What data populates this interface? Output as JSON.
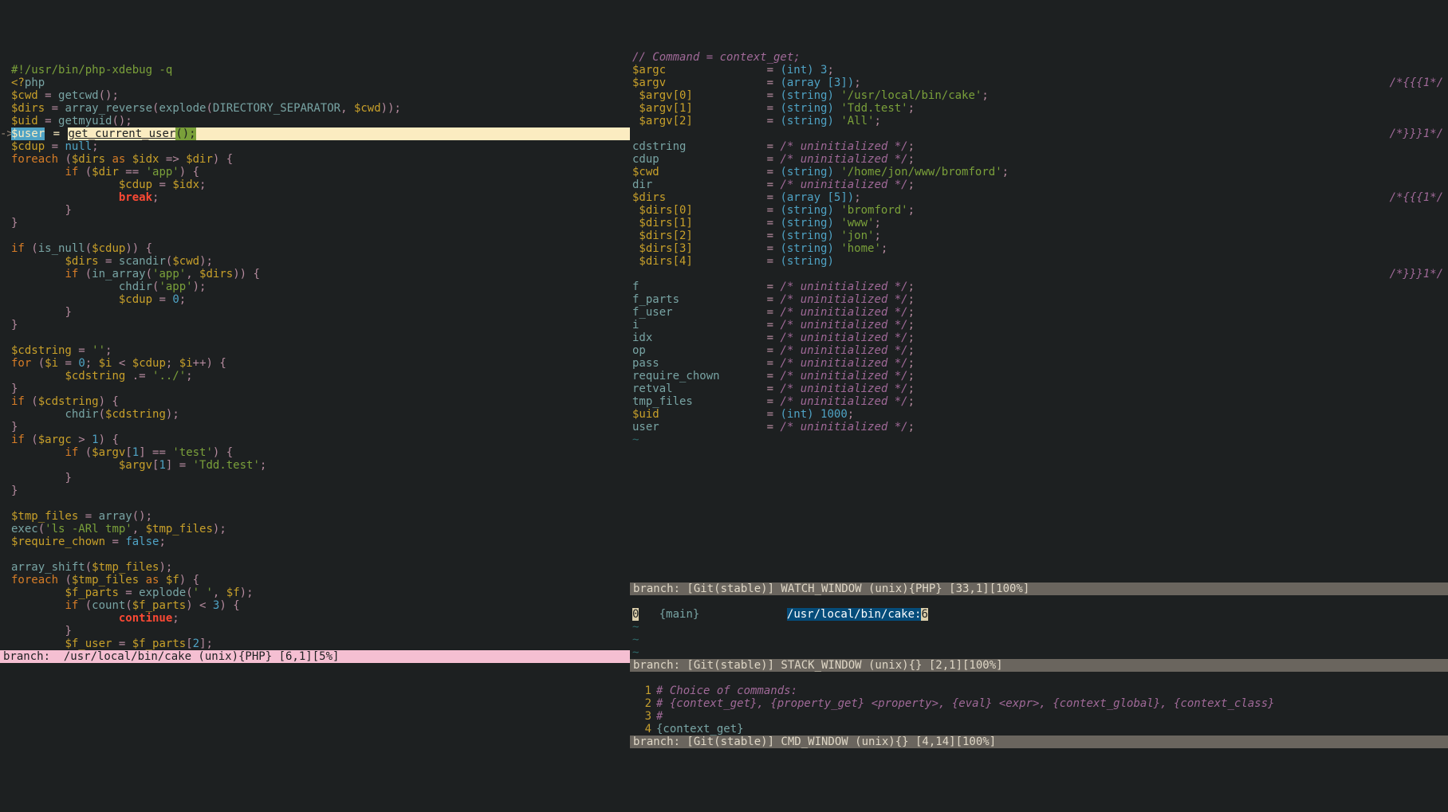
{
  "left": {
    "code": {
      "l1": "#!/usr/bin/php-xdebug -q",
      "l2": "<?php",
      "l3_pre": "$cwd",
      "l3_mid": " = ",
      "l3_fn": "getcwd",
      "l3_post": "();",
      "l4_pre": "$dirs",
      "l4_mid": " = ",
      "l4_fn": "array_reverse",
      "l4_a": "(",
      "l4_fn2": "explode",
      "l4_b": "(DIRECTORY_SEPARATOR, ",
      "l4_var": "$cwd",
      "l4_c": "));",
      "l5_pre": "$uid",
      "l5_mid": " = ",
      "l5_fn": "getmyuid",
      "l5_post": "();",
      "l6_pre": "$user",
      "l6_eq": " = ",
      "l6_fn": "get_current_user",
      "l6_post": "();",
      "l7_pre": "$cdup",
      "l7_mid": " = ",
      "l7_val": "null",
      "l7_post": ";",
      "l8": "foreach ($dirs as $idx => $dir) {",
      "l9": "        if ($dir == 'app') {",
      "l10": "                $cdup = $idx;",
      "l11": "                break;",
      "l12": "        }",
      "l13": "}",
      "l15": "if (is_null($cdup)) {",
      "l16": "        $dirs = scandir($cwd);",
      "l17": "        if (in_array('app', $dirs)) {",
      "l18": "                chdir('app');",
      "l19": "                $cdup = 0;",
      "l20": "        }",
      "l21": "}",
      "l23": "$cdstring = '';",
      "l24": "for ($i = 0; $i < $cdup; $i++) {",
      "l25": "        $cdstring .= '../';",
      "l26": "}",
      "l27": "if ($cdstring) {",
      "l28": "        chdir($cdstring);",
      "l29": "}",
      "l30": "if ($argc > 1) {",
      "l31": "        if ($argv[1] == 'test') {",
      "l32": "                $argv[1] = 'Tdd.test';",
      "l33": "        }",
      "l34": "}",
      "l36": "$tmp_files = array();",
      "l37": "exec('ls -ARl tmp', $tmp_files);",
      "l38": "$require_chown = false;",
      "l40": "array_shift($tmp_files);",
      "l41": "foreach ($tmp_files as $f) {",
      "l42": "        $f_parts = explode(' ', $f);",
      "l43": "        if (count($f_parts) < 3) {",
      "l44": "                continue;",
      "l45": "        }",
      "l46": "        $f_user = $f_parts[2];"
    },
    "status": "branch:  /usr/local/bin/cake (unix){PHP} [6,1][5%]"
  },
  "watch": {
    "header": "// Command = context_get;",
    "rows": [
      {
        "k": "$argc",
        "v": "= (int) 3;"
      },
      {
        "k": "$argv",
        "v": "= (array [3]);",
        "note": "/*{{{1*/"
      },
      {
        "k": " $argv[0]",
        "v": "= (string) '/usr/local/bin/cake';"
      },
      {
        "k": " $argv[1]",
        "v": "= (string) 'Tdd.test';"
      },
      {
        "k": " $argv[2]",
        "v": "= (string) 'All';"
      },
      {
        "k": "",
        "v": "",
        "note": "/*}}}1*/"
      },
      {
        "k": "cdstring",
        "v": "= /* uninitialized */;"
      },
      {
        "k": "cdup",
        "v": "= /* uninitialized */;"
      },
      {
        "k": "$cwd",
        "v": "= (string) '/home/jon/www/bromford';"
      },
      {
        "k": "dir",
        "v": "= /* uninitialized */;"
      },
      {
        "k": "$dirs",
        "v": "= (array [5]);",
        "note": "/*{{{1*/"
      },
      {
        "k": " $dirs[0]",
        "v": "= (string) 'bromford';"
      },
      {
        "k": " $dirs[1]",
        "v": "= (string) 'www';"
      },
      {
        "k": " $dirs[2]",
        "v": "= (string) 'jon';"
      },
      {
        "k": " $dirs[3]",
        "v": "= (string) 'home';"
      },
      {
        "k": " $dirs[4]",
        "v": "= (string)"
      },
      {
        "k": "",
        "v": "",
        "note": "/*}}}1*/"
      },
      {
        "k": "f",
        "v": "= /* uninitialized */;"
      },
      {
        "k": "f_parts",
        "v": "= /* uninitialized */;"
      },
      {
        "k": "f_user",
        "v": "= /* uninitialized */;"
      },
      {
        "k": "i",
        "v": "= /* uninitialized */;"
      },
      {
        "k": "idx",
        "v": "= /* uninitialized */;"
      },
      {
        "k": "op",
        "v": "= /* uninitialized */;"
      },
      {
        "k": "pass",
        "v": "= /* uninitialized */;"
      },
      {
        "k": "require_chown",
        "v": "= /* uninitialized */;"
      },
      {
        "k": "retval",
        "v": "= /* uninitialized */;"
      },
      {
        "k": "tmp_files",
        "v": "= /* uninitialized */;"
      },
      {
        "k": "$uid",
        "v": "= (int) 1000;"
      },
      {
        "k": "user",
        "v": "= /* uninitialized */;"
      }
    ],
    "status": "branch: [Git(stable)] WATCH_WINDOW (unix){PHP} [33,1][100%]"
  },
  "stack": {
    "line": "0   {main}             /usr/local/bin/cake:6",
    "status": "branch: [Git(stable)] STACK_WINDOW (unix){} [2,1][100%]"
  },
  "cmd": {
    "l1": "# Choice of commands:",
    "l2": "# {context_get}, {property_get} <property>, {eval} <expr>, {context_global}, {context_class}",
    "l3": "#",
    "l4": "{context_get}",
    "status": "branch: [Git(stable)] CMD_WINDOW (unix){} [4,14][100%]"
  }
}
